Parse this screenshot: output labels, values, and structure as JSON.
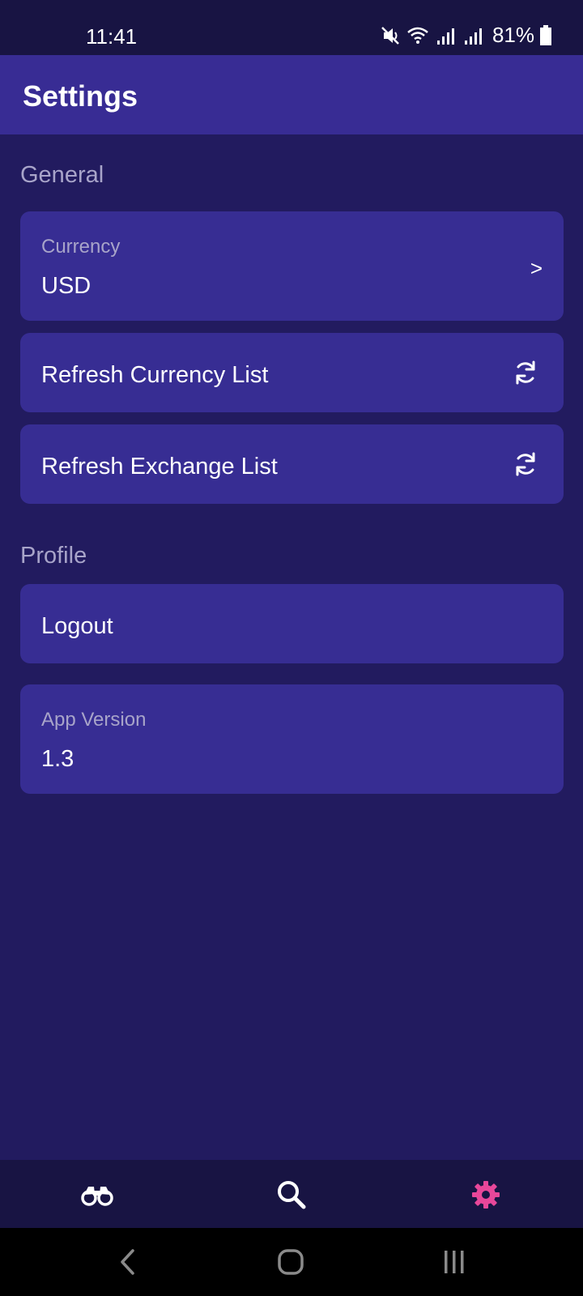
{
  "status_bar": {
    "time": "11:41",
    "battery_percent": "81%",
    "icons": [
      "mute-icon",
      "wifi-icon",
      "signal-icon",
      "signal-icon",
      "battery-icon"
    ]
  },
  "header": {
    "title": "Settings"
  },
  "sections": {
    "general_label": "General",
    "profile_label": "Profile"
  },
  "settings": {
    "currency": {
      "label": "Currency",
      "value": "USD",
      "chevron": ">"
    },
    "refresh_currency": {
      "label": "Refresh Currency List",
      "icon": "refresh-icon"
    },
    "refresh_exchange": {
      "label": "Refresh Exchange List",
      "icon": "refresh-icon"
    },
    "logout": {
      "label": "Logout"
    },
    "app_version": {
      "label": "App Version",
      "value": "1.3"
    }
  },
  "bottom_nav": {
    "items": [
      {
        "icon": "binoculars-icon",
        "active": false
      },
      {
        "icon": "search-icon",
        "active": false
      },
      {
        "icon": "gear-icon",
        "active": true
      }
    ],
    "active_color": "#e8479a",
    "inactive_color": "#ffffff"
  },
  "colors": {
    "background": "#221b5f",
    "app_bar": "#382c94",
    "card": "#372d93",
    "status_bar": "#181443",
    "secondary_text": "#a8a4c9"
  }
}
